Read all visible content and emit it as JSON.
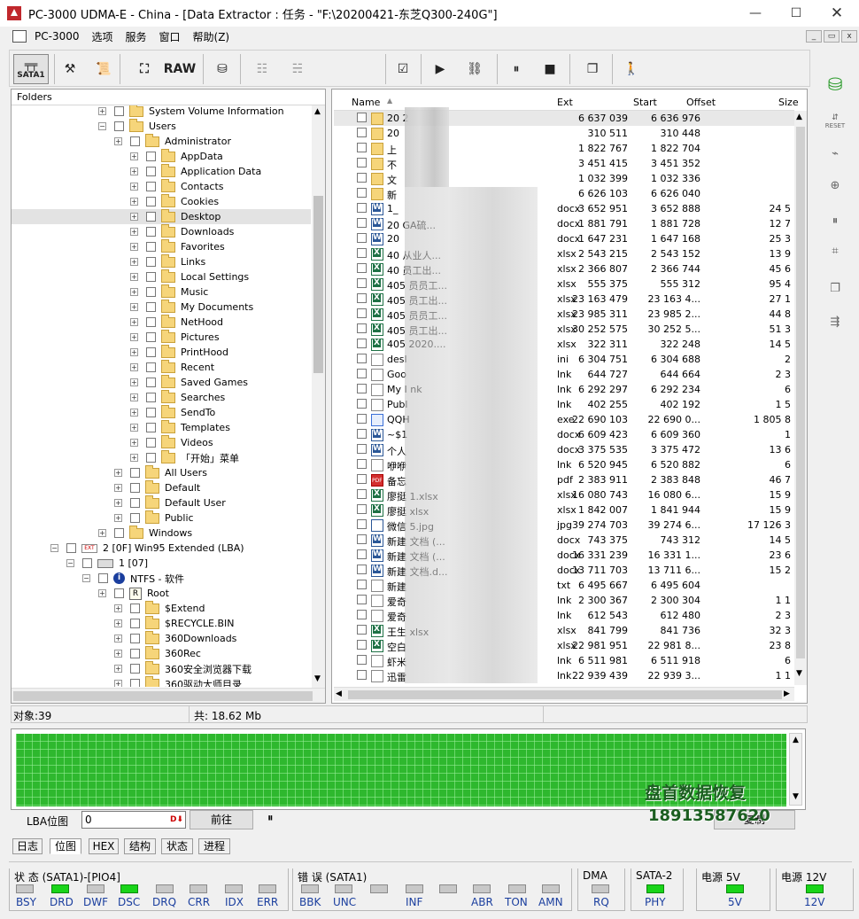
{
  "window": {
    "title": "PC-3000 UDMA-E - China - [Data Extractor : 任务 - \"F:\\20200421-东芝Q300-240G\"]"
  },
  "menu": [
    "PC-3000",
    "选项",
    "服务",
    "窗口",
    "帮助(Z)"
  ],
  "toolbar": {
    "sata_label": "SATA1",
    "raw_label": "RAW"
  },
  "folders": {
    "header": "Folders",
    "rows": [
      "System Volume Information",
      "Users",
      "Administrator",
      "AppData",
      "Application Data",
      "Contacts",
      "Cookies",
      "Desktop",
      "Downloads",
      "Favorites",
      "Links",
      "Local Settings",
      "Music",
      "My Documents",
      "NetHood",
      "Pictures",
      "PrintHood",
      "Recent",
      "Saved Games",
      "Searches",
      "SendTo",
      "Templates",
      "Videos",
      "「开始」菜单",
      "All Users",
      "Default",
      "Default User",
      "Public",
      "Windows",
      "2 [0F] Win95 Extended  (LBA)",
      "1 [07]",
      "NTFS - 软件",
      "Root",
      "$Extend",
      "$RECYCLE.BIN",
      "360Downloads",
      "360Rec",
      "360安全浏览器下载",
      "360驱动大师目录"
    ]
  },
  "files": {
    "columns": [
      "Name",
      "Ext",
      "Start",
      "Offset",
      "Size"
    ],
    "rows": [
      {
        "name": "20      2",
        "ext": "",
        "start": "6 637 039",
        "offset": "6 636 976",
        "size": ""
      },
      {
        "name": "20",
        "ext": "",
        "start": "310 511",
        "offset": "310 448",
        "size": ""
      },
      {
        "name": "上",
        "ext": "",
        "start": "1 822 767",
        "offset": "1 822 704",
        "size": ""
      },
      {
        "name": "不",
        "ext": "",
        "start": "3 451 415",
        "offset": "3 451 352",
        "size": ""
      },
      {
        "name": "文",
        "ext": "",
        "start": "1 032 399",
        "offset": "1 032 336",
        "size": ""
      },
      {
        "name": "新",
        "ext": "",
        "start": "6 626 103",
        "offset": "6 626 040",
        "size": ""
      },
      {
        "name": "1_",
        "ext": "docx",
        "start": "3 652 951",
        "offset": "3 652 888",
        "size": "24 5"
      },
      {
        "name": "20                   GA硫...",
        "ext": "docx",
        "start": "1 881 791",
        "offset": "1 881 728",
        "size": "12 7"
      },
      {
        "name": "20",
        "ext": "docx",
        "start": "1 647 231",
        "offset": "1 647 168",
        "size": "25 3"
      },
      {
        "name": "40                   从业人...",
        "ext": "xlsx",
        "start": "2 543 215",
        "offset": "2 543 152",
        "size": "13 9"
      },
      {
        "name": "40                   员工出...",
        "ext": "xlsx",
        "start": "2 366 807",
        "offset": "2 366 744",
        "size": "45 6"
      },
      {
        "name": "405                  员员工...",
        "ext": "xlsx",
        "start": "555 375",
        "offset": "555 312",
        "size": "95 4"
      },
      {
        "name": "405                  员工出...",
        "ext": "xlsx",
        "start": "23 163 479",
        "offset": "23 163 4...",
        "size": "27 1"
      },
      {
        "name": "405                  员员工...",
        "ext": "xlsx",
        "start": "23 985 311",
        "offset": "23 985 2...",
        "size": "44 8"
      },
      {
        "name": "405                  员工出...",
        "ext": "xlsx",
        "start": "30 252 575",
        "offset": "30 252 5...",
        "size": "51 3"
      },
      {
        "name": "405                  2020....",
        "ext": "xlsx",
        "start": "322 311",
        "offset": "322 248",
        "size": "14 5"
      },
      {
        "name": "desl",
        "ext": "ini",
        "start": "6 304 751",
        "offset": "6 304 688",
        "size": "2"
      },
      {
        "name": "Goo",
        "ext": "lnk",
        "start": "644 727",
        "offset": "644 664",
        "size": "2 3"
      },
      {
        "name": "My I                   nk",
        "ext": "lnk",
        "start": "6 292 297",
        "offset": "6 292 234",
        "size": "6"
      },
      {
        "name": "Publ",
        "ext": "lnk",
        "start": "402 255",
        "offset": "402 192",
        "size": "1 5"
      },
      {
        "name": "QQH",
        "ext": "exe",
        "start": "22 690 103",
        "offset": "22 690 0...",
        "size": "1 805 8"
      },
      {
        "name": "~$1",
        "ext": "docx",
        "start": "6 609 423",
        "offset": "6 609 360",
        "size": "1"
      },
      {
        "name": "个人",
        "ext": "docx",
        "start": "3 375 535",
        "offset": "3 375 472",
        "size": "13 6"
      },
      {
        "name": "咿咿",
        "ext": "lnk",
        "start": "6 520 945",
        "offset": "6 520 882",
        "size": "6"
      },
      {
        "name": "备忘",
        "ext": "pdf",
        "start": "2 383 911",
        "offset": "2 383 848",
        "size": "46 7"
      },
      {
        "name": "廖挺                  1.xlsx",
        "ext": "xlsx",
        "start": "16 080 743",
        "offset": "16 080 6...",
        "size": "15 9"
      },
      {
        "name": "廖挺                 xlsx",
        "ext": "xlsx",
        "start": "1 842 007",
        "offset": "1 841 944",
        "size": "15 9"
      },
      {
        "name": "微信                 5.jpg",
        "ext": "jpg",
        "start": "39 274 703",
        "offset": "39 274 6...",
        "size": "17 126 3"
      },
      {
        "name": "新建                 文档 (...",
        "ext": "docx",
        "start": "743 375",
        "offset": "743 312",
        "size": "14 5"
      },
      {
        "name": "新建                 文档 (...",
        "ext": "docx",
        "start": "16 331 239",
        "offset": "16 331 1...",
        "size": "23 6"
      },
      {
        "name": "新建                 文档.d...",
        "ext": "docx",
        "start": "13 711 703",
        "offset": "13 711 6...",
        "size": "15 2"
      },
      {
        "name": "新建",
        "ext": "txt",
        "start": "6 495 667",
        "offset": "6 495 604",
        "size": ""
      },
      {
        "name": "爱奇",
        "ext": "lnk",
        "start": "2 300 367",
        "offset": "2 300 304",
        "size": "1 1"
      },
      {
        "name": "爱奇",
        "ext": "lnk",
        "start": "612 543",
        "offset": "612 480",
        "size": "2 3"
      },
      {
        "name": "王生          xlsx",
        "ext": "xlsx",
        "start": "841 799",
        "offset": "841 736",
        "size": "32 3"
      },
      {
        "name": "空白",
        "ext": "xlsx",
        "start": "22 981 951",
        "offset": "22 981 8...",
        "size": "23 8"
      },
      {
        "name": "虾米",
        "ext": "lnk",
        "start": "6 511 981",
        "offset": "6 511 918",
        "size": "6"
      },
      {
        "name": "迅雷",
        "ext": "lnk",
        "start": "22 939 439",
        "offset": "22 939 3...",
        "size": "1 1"
      }
    ]
  },
  "status": {
    "objects": "对象:39",
    "total": "共: 18.62 Mb"
  },
  "lba": {
    "label": "LBA位图",
    "value": "0",
    "go_label": "前往",
    "pause": "⏸"
  },
  "tabs": [
    "日志",
    "位图",
    "HEX",
    "结构",
    "状态",
    "进程"
  ],
  "indicators": {
    "status_title": "状 态 (SATA1)-[PIO4]",
    "status_leds": [
      {
        "label": "BSY",
        "on": false
      },
      {
        "label": "DRD",
        "on": true
      },
      {
        "label": "DWF",
        "on": false
      },
      {
        "label": "DSC",
        "on": true
      },
      {
        "label": "DRQ",
        "on": false
      },
      {
        "label": "CRR",
        "on": false
      },
      {
        "label": "IDX",
        "on": false
      },
      {
        "label": "ERR",
        "on": false
      }
    ],
    "error_title": "错 误 (SATA1)",
    "error_leds": [
      {
        "label": "BBK",
        "on": false
      },
      {
        "label": "UNC",
        "on": false
      },
      {
        "label": "",
        "on": false
      },
      {
        "label": "INF",
        "on": false
      },
      {
        "label": "",
        "on": false
      },
      {
        "label": "ABR",
        "on": false
      },
      {
        "label": "TON",
        "on": false
      },
      {
        "label": "AMN",
        "on": false
      }
    ],
    "dma_title": "DMA",
    "dma_led": {
      "label": "RQ",
      "on": false
    },
    "sata_title": "SATA-2",
    "sata_led": {
      "label": "PHY",
      "on": true
    },
    "p5_title": "电源 5V",
    "p5_led": {
      "label": "5V",
      "on": true
    },
    "p12_title": "电源 12V",
    "p12_led": {
      "label": "12V",
      "on": true
    }
  },
  "watermark": {
    "line1": "盘首数据恢复",
    "line2": "18913587620",
    "button": "复制"
  },
  "colors": {
    "led_on": "#19d419",
    "grid_green": "#1e8c1e",
    "watermark": "#1b5e20"
  }
}
